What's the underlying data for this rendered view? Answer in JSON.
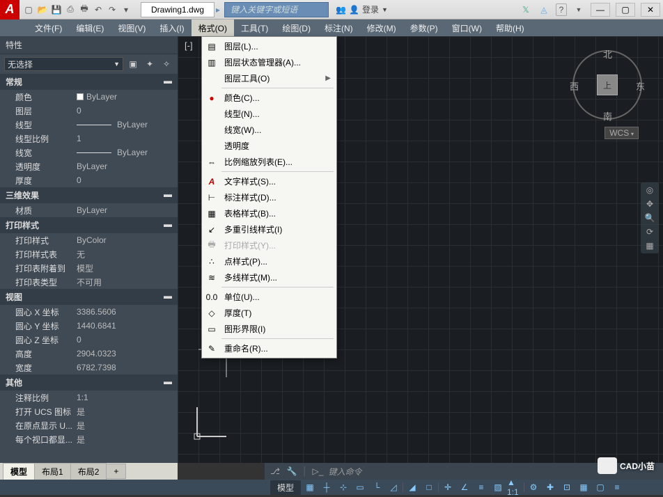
{
  "title": {
    "doc": "Drawing1.dwg",
    "search_placeholder": "键入关键字或短语",
    "login": "登录"
  },
  "menubar": [
    {
      "label": "文件(F)"
    },
    {
      "label": "编辑(E)"
    },
    {
      "label": "视图(V)"
    },
    {
      "label": "插入(I)"
    },
    {
      "label": "格式(O)",
      "active": true
    },
    {
      "label": "工具(T)"
    },
    {
      "label": "绘图(D)"
    },
    {
      "label": "标注(N)"
    },
    {
      "label": "修改(M)"
    },
    {
      "label": "参数(P)"
    },
    {
      "label": "窗口(W)"
    },
    {
      "label": "帮助(H)"
    }
  ],
  "dropdown": [
    {
      "icon": "layers",
      "label": "图层(L)..."
    },
    {
      "icon": "layers-mgr",
      "label": "图层状态管理器(A)..."
    },
    {
      "icon": "",
      "label": "图层工具(O)",
      "arrow": true
    },
    {
      "sep": true
    },
    {
      "icon": "color",
      "label": "颜色(C)..."
    },
    {
      "icon": "",
      "label": "线型(N)..."
    },
    {
      "icon": "",
      "label": "线宽(W)..."
    },
    {
      "icon": "",
      "label": "透明度"
    },
    {
      "icon": "scale",
      "label": "比例缩放列表(E)..."
    },
    {
      "sep": true
    },
    {
      "icon": "text-a",
      "label": "文字样式(S)..."
    },
    {
      "icon": "dim",
      "label": "标注样式(D)..."
    },
    {
      "icon": "table",
      "label": "表格样式(B)..."
    },
    {
      "icon": "mleader",
      "label": "多重引线样式(I)"
    },
    {
      "icon": "print",
      "label": "打印样式(Y)...",
      "disabled": true
    },
    {
      "icon": "point",
      "label": "点样式(P)..."
    },
    {
      "icon": "mline",
      "label": "多线样式(M)..."
    },
    {
      "sep": true
    },
    {
      "icon": "units",
      "label": "单位(U)..."
    },
    {
      "icon": "thick",
      "label": "厚度(T)"
    },
    {
      "icon": "limits",
      "label": "图形界限(I)"
    },
    {
      "sep": true
    },
    {
      "icon": "rename",
      "label": "重命名(R)..."
    }
  ],
  "props": {
    "title": "特性",
    "selection": "无选择",
    "sections": [
      {
        "name": "常规",
        "rows": [
          {
            "label": "颜色",
            "value": "ByLayer",
            "swatch": true
          },
          {
            "label": "图层",
            "value": "0"
          },
          {
            "label": "线型",
            "value": "ByLayer",
            "line": true
          },
          {
            "label": "线型比例",
            "value": "1"
          },
          {
            "label": "线宽",
            "value": "ByLayer",
            "line": true
          },
          {
            "label": "透明度",
            "value": "ByLayer"
          },
          {
            "label": "厚度",
            "value": "0"
          }
        ]
      },
      {
        "name": "三维效果",
        "rows": [
          {
            "label": "材质",
            "value": "ByLayer"
          }
        ]
      },
      {
        "name": "打印样式",
        "rows": [
          {
            "label": "打印样式",
            "value": "ByColor"
          },
          {
            "label": "打印样式表",
            "value": "无"
          },
          {
            "label": "打印表附着到",
            "value": "模型"
          },
          {
            "label": "打印表类型",
            "value": "不可用"
          }
        ]
      },
      {
        "name": "视图",
        "rows": [
          {
            "label": "圆心 X 坐标",
            "value": "3386.5606"
          },
          {
            "label": "圆心 Y 坐标",
            "value": "1440.6841"
          },
          {
            "label": "圆心 Z 坐标",
            "value": "0"
          },
          {
            "label": "高度",
            "value": "2904.0323"
          },
          {
            "label": "宽度",
            "value": "6782.7398"
          }
        ]
      },
      {
        "name": "其他",
        "rows": [
          {
            "label": "注释比例",
            "value": "1:1"
          },
          {
            "label": "打开 UCS 图标",
            "value": "是"
          },
          {
            "label": "在原点显示 U...",
            "value": "是"
          },
          {
            "label": "每个视口都显...",
            "value": "是"
          }
        ]
      }
    ]
  },
  "layout_tabs": [
    {
      "label": "模型",
      "active": true
    },
    {
      "label": "布局1"
    },
    {
      "label": "布局2"
    }
  ],
  "viewcube": {
    "n": "北",
    "s": "南",
    "e": "东",
    "w": "西",
    "top": "上",
    "wcs": "WCS"
  },
  "canvas_overlay": "[-]",
  "cmdline": {
    "prompt": "键入命令"
  },
  "statusbar": {
    "model": "模型"
  },
  "watermark": "CAD小苗"
}
